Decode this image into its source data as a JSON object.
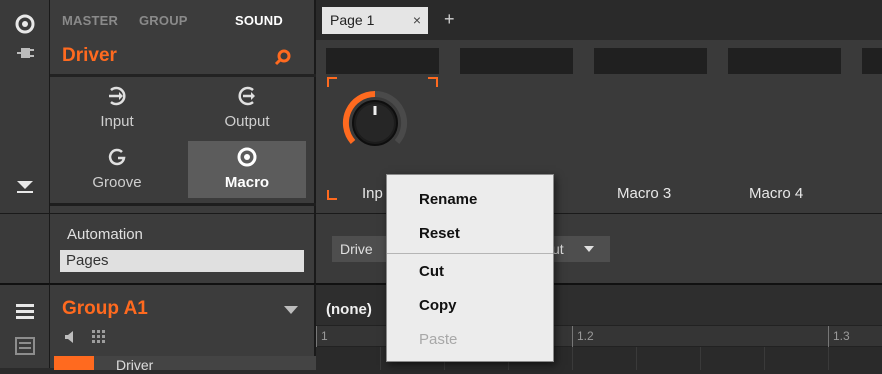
{
  "sound_panel": {
    "tabs": [
      "MASTER",
      "GROUP",
      "SOUND"
    ],
    "active_tab": "SOUND",
    "title": "Driver",
    "nav": [
      {
        "label": "Input",
        "icon": "input-icon"
      },
      {
        "label": "Output",
        "icon": "output-icon"
      },
      {
        "label": "Groove",
        "icon": "groove-icon"
      },
      {
        "label": "Macro",
        "icon": "macro-icon"
      }
    ],
    "active_nav": "Macro"
  },
  "macro": {
    "page_tab": "Page 1",
    "page_tab_close": "×",
    "add_tab": "+",
    "labels": [
      "Inp",
      "Macro 3",
      "Macro 4"
    ]
  },
  "automation": {
    "label": "Automation",
    "pages_value": "Pages",
    "driver_dropdown": "Drive",
    "input_dropdown": "ut"
  },
  "group": {
    "title": "Group A1",
    "driver_row": "Driver"
  },
  "timeline": {
    "none_label": "(none)",
    "ruler": [
      "1",
      "1.2",
      "1.3"
    ]
  },
  "context_menu": {
    "items": [
      {
        "label": "Rename",
        "enabled": true
      },
      {
        "label": "Reset",
        "enabled": true
      },
      {
        "label": "Cut",
        "enabled": true
      },
      {
        "label": "Copy",
        "enabled": true
      },
      {
        "label": "Paste",
        "enabled": false
      }
    ]
  },
  "colors": {
    "accent": "#ff6a1f",
    "background": "#2b2b2b",
    "panel": "#3c3c3c",
    "menu_bg": "#ececec"
  }
}
